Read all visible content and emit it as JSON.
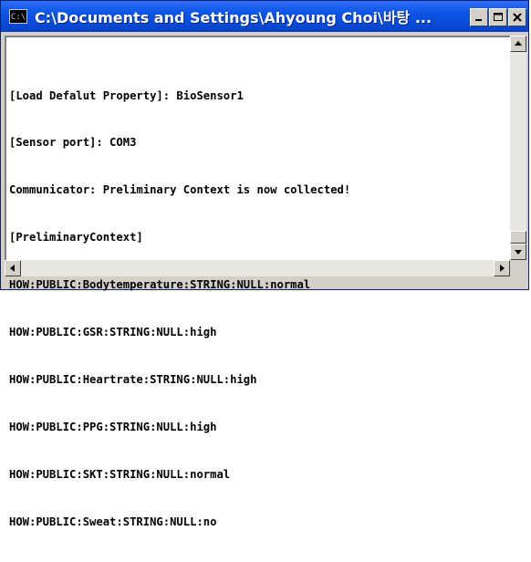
{
  "window": {
    "title": "C:\\Documents and Settings\\Ahyoung Choi\\바탕 ...",
    "icon_label": "C:\\",
    "controls": {
      "minimize_icon": "minimize-icon",
      "maximize_icon": "maximize-icon",
      "close_icon": "close-icon"
    }
  },
  "console": {
    "lines": [
      "[Load Defalut Property]: BioSensor1",
      "[Sensor port]: COM3",
      "Communicator: Preliminary Context is now collected!",
      "[PreliminaryContext]",
      "HOW:PUBLIC:Bodytemperature:STRING:NULL:normal",
      "HOW:PUBLIC:GSR:STRING:NULL:high",
      "HOW:PUBLIC:Heartrate:STRING:NULL:high",
      "HOW:PUBLIC:PPG:STRING:NULL:high",
      "HOW:PUBLIC:SKT:STRING:NULL:normal",
      "HOW:PUBLIC:Sweat:STRING:NULL:no"
    ]
  },
  "colors": {
    "titlebar": "#0b55e6",
    "console_bg": "#ffffff",
    "console_text": "#000000",
    "chrome": "#d4d0c8"
  }
}
